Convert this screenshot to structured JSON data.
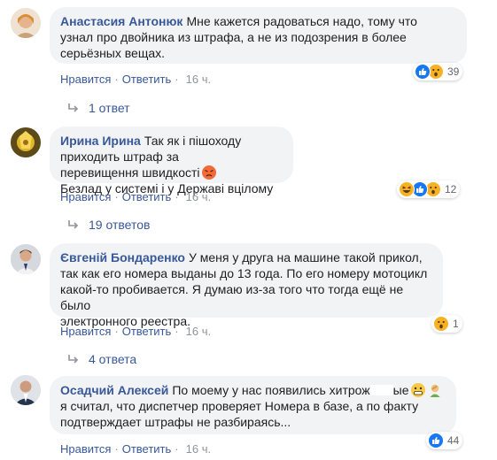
{
  "comments": [
    {
      "author": "Анастасия Антонюк",
      "lines": [
        "Мне кажется радоваться надо, тому что",
        "узнал про двойника из штрафа, а не из подозрения в более",
        "серьёзных вещах."
      ],
      "like_label": "Нравится",
      "reply_label": "Ответить",
      "time": "16 ч.",
      "reaction_count": "39",
      "reaction_icons": [
        "like-icon",
        "wow-icon"
      ],
      "replies_label": "1 ответ"
    },
    {
      "author": "Ирина Ирина",
      "lines": [
        "Так як і пішоходу приходить штраф за",
        "перевищення швидкості",
        "Безлад у системі і у Державі вцілому"
      ],
      "like_label": "Нравится",
      "reply_label": "Ответить",
      "time": "16 ч.",
      "reaction_count": "12",
      "reaction_icons": [
        "haha-icon",
        "like-icon",
        "wow-icon"
      ],
      "replies_label": "19 ответов"
    },
    {
      "author": "Євгеній Бондаренко",
      "lines": [
        "У меня у друга на машине такой прикол,",
        "так как его номера выданы до 13 года. По его номеру мотоцикл",
        "какой-то пробивается. Я думаю из-за того что тогда ещё не было",
        "электронного реестра."
      ],
      "like_label": "Нравится",
      "reply_label": "Ответить",
      "time": "16 ч.",
      "reaction_count": "1",
      "reaction_icons": [
        "wow-icon"
      ],
      "replies_label": "4 ответа"
    },
    {
      "author": "Осадчий Алексей",
      "lines": [
        "По моему у нас появились хитрож",
        "ые",
        "я считал, что диспетчер проверяет Номера в базе, а по факту",
        "подтверждает штрафы не разбираясь..."
      ],
      "like_label": "Нравится",
      "reply_label": "Ответить",
      "time": "16 ч.",
      "reaction_count": "44",
      "reaction_icons": [
        "like-icon"
      ]
    }
  ],
  "colors": {
    "link": "#385898",
    "bubble": "#f2f3f5",
    "meta": "#90949c",
    "like": "#1877f2",
    "wow": "#f7b125"
  }
}
